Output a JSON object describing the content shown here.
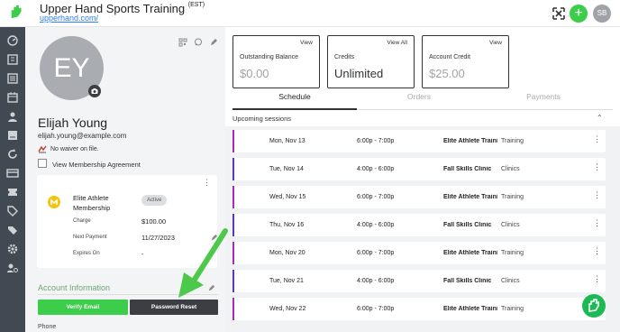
{
  "header": {
    "title": "Upper Hand Sports Training",
    "timezone": "(EST)",
    "url": "upperhand.com/",
    "avatar_initials": "SB"
  },
  "profile": {
    "initials": "EY",
    "name": "Elijah Young",
    "email": "elijah.young@example.com",
    "waiver": "No waiver on file.",
    "agreement": "View Membership Agreement",
    "membership": {
      "name_line1": "Elite Athlete",
      "name_line2": "Membership",
      "status": "Active",
      "charge_label": "Charge",
      "charge_value": "$100.00",
      "next_label": "Next Payment",
      "next_value": "11/27/2023",
      "expires_label": "Expires On",
      "expires_value": "-"
    },
    "account_heading": "Account Information",
    "verify_label": "Verify Email",
    "reset_label": "Password Reset",
    "phone_label": "Phone"
  },
  "cards": [
    {
      "link": "View",
      "title": "Outstanding Balance",
      "value": "$0.00"
    },
    {
      "link": "View All",
      "title": "Credits",
      "value": "Unlimited"
    },
    {
      "link": "View",
      "title": "Account Credit",
      "value": "$25.00"
    }
  ],
  "tabs": [
    "Schedule",
    "Orders",
    "Payments"
  ],
  "sessions_heading": "Upcoming sessions",
  "sessions": [
    {
      "date": "Mon, Nov 13",
      "time": "6:00p - 7:00p",
      "event": "Elite Athlete Training",
      "type": "Training",
      "color": "#a62fb0"
    },
    {
      "date": "Tue, Nov 14",
      "time": "4:00p - 6:00p",
      "event": "Fall Skills Clinic",
      "type": "Clinics",
      "color": "#5b3ab5"
    },
    {
      "date": "Wed, Nov 15",
      "time": "6:00p - 7:00p",
      "event": "Elite Athlete Training",
      "type": "Training",
      "color": "#a62fb0"
    },
    {
      "date": "Thu, Nov 16",
      "time": "4:00p - 6:00p",
      "event": "Fall Skills Clinic",
      "type": "Clinics",
      "color": "#5b3ab5"
    },
    {
      "date": "Mon, Nov 20",
      "time": "6:00p - 7:00p",
      "event": "Elite Athlete Training",
      "type": "Training",
      "color": "#a62fb0"
    },
    {
      "date": "Tue, Nov 21",
      "time": "4:00p - 6:00p",
      "event": "Fall Skills Clinic",
      "type": "Clinics",
      "color": "#5b3ab5"
    },
    {
      "date": "Wed, Nov 22",
      "time": "6:00p - 7:00p",
      "event": "Elite Athlete Training",
      "type": "Training",
      "color": "#a62fb0"
    }
  ],
  "colors": {
    "sidebar": "#414a52",
    "accent_green": "#3ccd4a",
    "dark_button": "#3b3f43",
    "arrow": "#4cc94a"
  }
}
